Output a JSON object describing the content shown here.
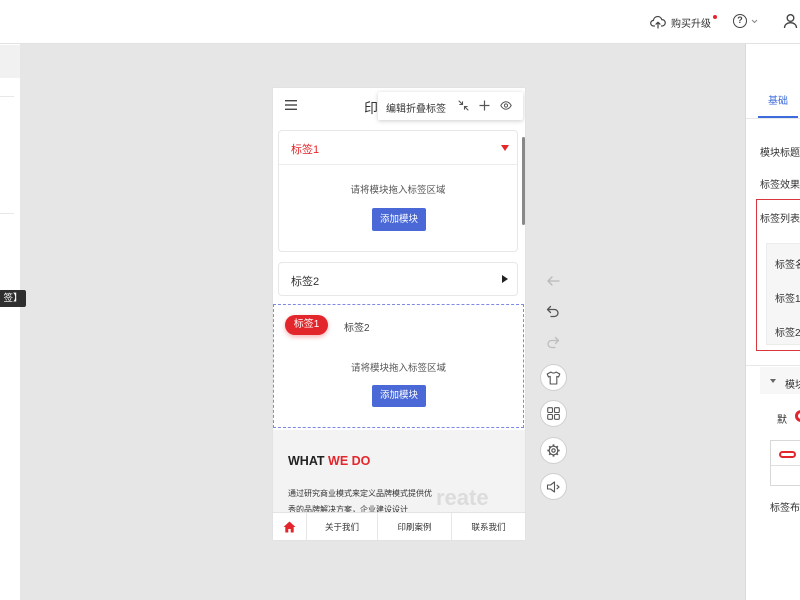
{
  "topbar": {
    "upgrade": {
      "label": "购买升级",
      "icon": "cloud-upload-icon",
      "badge": "dot"
    },
    "help": {
      "label": "?",
      "icon": "help-circle-icon"
    },
    "user": {
      "icon": "user-icon"
    }
  },
  "left_panel": {
    "tooltip": "签】"
  },
  "phone": {
    "header": {
      "title": "印",
      "menu_icon": "hamburger-icon"
    },
    "toolbar": {
      "label": "编辑折叠标签",
      "icons": [
        "collapse-arrows-icon",
        "plus-icon",
        "eye-icon"
      ]
    },
    "collapse_items": [
      {
        "label": "标签1",
        "expanded": true,
        "indicator": "caret-down-icon",
        "placeholder": "请将模块拖入标签区域",
        "button": "添加模块"
      },
      {
        "label": "标签2",
        "expanded": false,
        "indicator": "caret-right-icon"
      }
    ],
    "tabs": {
      "items": [
        {
          "label": "标签1",
          "active": true
        },
        {
          "label": "标签2",
          "active": false
        }
      ],
      "placeholder": "请将模块拖入标签区域",
      "button": "添加模块"
    },
    "section": {
      "heading": {
        "part1": "WHAT",
        "part2": "WE DO"
      },
      "lines": [
        "通过研究商业模式来定义品牌模式提供优",
        "秀的品牌解决方案，企业建设设计"
      ],
      "watermark": "reate"
    },
    "footer": [
      {
        "icon": "home-icon"
      },
      {
        "label": "关于我们"
      },
      {
        "label": "印刷案例"
      },
      {
        "label": "联系我们"
      }
    ]
  },
  "side_tools": {
    "history": [
      "back-arrow-icon",
      "undo-icon",
      "redo-icon"
    ],
    "buttons": [
      "tshirt-icon",
      "grid-icon",
      "gear-icon",
      "speaker-icon"
    ]
  },
  "right_panel": {
    "tab": "基础",
    "fields": {
      "module_title": "模块标题：",
      "tab_effect": "标签效果：",
      "tab_list": "标签列表："
    },
    "list": {
      "header": "标签名",
      "items": [
        "标签1",
        "标签2"
      ]
    },
    "group": {
      "label": "模块",
      "icon": "caret-down-icon"
    },
    "default_option": "默",
    "layout_label": "标签布"
  },
  "colors": {
    "accent_red": "#e3262b",
    "button_blue": "#4a68d6",
    "tab_blue": "#3c6ddb",
    "canvas_bg": "#e6e6e6",
    "selection_dashed": "#7f88e2"
  }
}
